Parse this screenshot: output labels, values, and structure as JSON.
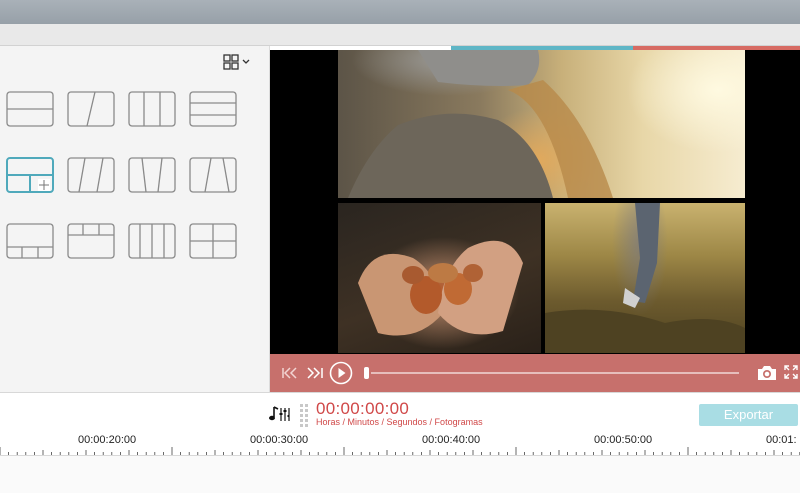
{
  "layout_menu": {
    "icon": "grid-layout-icon",
    "chevron": "chevron-down-icon"
  },
  "templates": [
    {
      "id": "tpl-2-rows"
    },
    {
      "id": "tpl-2-diagonal"
    },
    {
      "id": "tpl-3-columns"
    },
    {
      "id": "tpl-3-rows"
    },
    {
      "id": "tpl-2-plus-2-selected",
      "selected": true
    },
    {
      "id": "tpl-3-diagonal"
    },
    {
      "id": "tpl-3-trapezoid"
    },
    {
      "id": "tpl-2-trapezoid"
    },
    {
      "id": "tpl-1-plus-3"
    },
    {
      "id": "tpl-3-plus-1"
    },
    {
      "id": "tpl-4-columns"
    },
    {
      "id": "tpl-4-grid"
    }
  ],
  "player": {
    "controls": [
      "skip-back-icon",
      "skip-forward-icon",
      "play-icon",
      "camera-icon",
      "fullscreen-icon"
    ],
    "progress": 0.0
  },
  "timeline": {
    "timecode": "00:00:00:00",
    "timecode_caption": "Horas / Minutos / Segundos / Fotogramas",
    "export_label": "Exportar",
    "ruler_labels": [
      "00:00:20:00",
      "00:00:30:00",
      "00:00:40:00",
      "00:00:50:00",
      "00:01:"
    ]
  },
  "colors": {
    "accent_red": "#c7706c",
    "accent_teal": "#5fb6c6",
    "timecode_red": "#d04848",
    "export_bg": "#a9dde4"
  }
}
